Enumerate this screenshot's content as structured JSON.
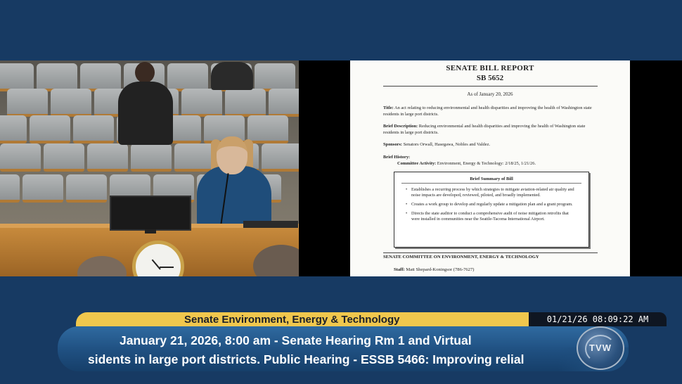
{
  "document": {
    "title": "SENATE BILL REPORT",
    "bill_number": "SB 5652",
    "as_of": "As of January 20, 2026",
    "title_label": "Title:",
    "title_text": "An act relating to reducing environmental and health disparities and improving the health of Washington state residents in large port districts.",
    "brief_description_label": "Brief Description:",
    "brief_description_text": "Reducing environmental and health disparities and improving the health of Washington state residents in large port districts.",
    "sponsors_label": "Sponsors:",
    "sponsors_text": "Senators Orwall, Hasegawa, Nobles and Valdez.",
    "brief_history_label": "Brief History:",
    "committee_activity_label": "Committee Activity:",
    "committee_activity_text": "Environment, Energy & Technology: 2/18/25, 1/21/26.",
    "summary_title": "Brief Summary of Bill",
    "summary_bullets": [
      "Establishes a recurring process by which strategies to mitigate aviation-related air quality and noise impacts are developed, reviewed, piloted, and broadly implemented.",
      "Creates a work group to develop and regularly update a mitigation plan and a grant program.",
      "Directs the state auditor to conduct a comprehensive audit of noise mitigation retrofits that were installed in communities near the Seattle-Tacoma International Airport."
    ],
    "committee_heading": "SENATE COMMITTEE ON ENVIRONMENT, ENERGY & TECHNOLOGY",
    "staff_label": "Staff:",
    "staff_text": "Matt Shepard-Koningsor (786-7627)"
  },
  "broadcast": {
    "committee_title": "Senate Environment, Energy & Technology",
    "timestamp": "01/21/26 08:09:22 AM",
    "session_line": "January 21, 2026, 8:00 am - Senate Hearing Rm 1 and Virtual",
    "crawl_line": "sidents in large port districts. Public Hearing -   ESSB 5466: Improving relial",
    "logo_text": "TVW"
  },
  "colors": {
    "background": "#173a63",
    "title_bar": "#f0c74d",
    "info_bar": "#1f4f80"
  }
}
